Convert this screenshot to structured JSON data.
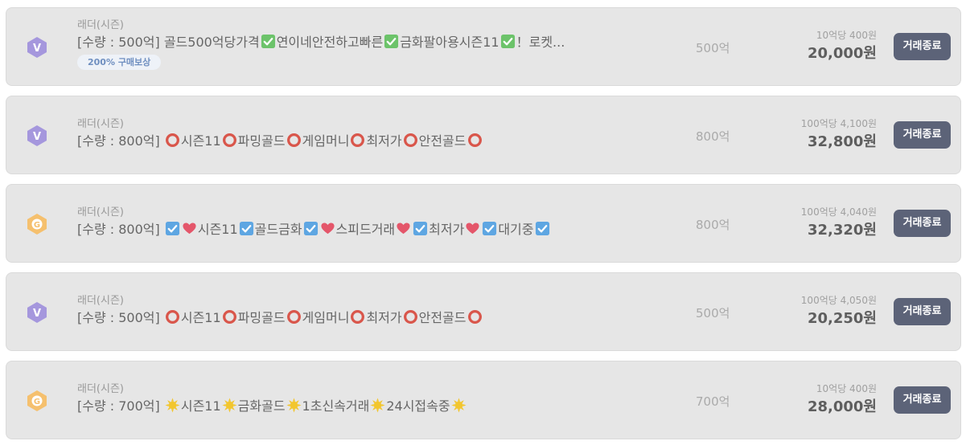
{
  "colors": {
    "card_bg": "#e6e6e6",
    "button_bg": "#5c6378",
    "badge_v": "#a597dd",
    "badge_g": "#f5c06e"
  },
  "listings": [
    {
      "badge": "v-badge-icon",
      "badge_letter": "V",
      "category": "래더(시즌)",
      "title_parts": [
        {
          "t": "[수량 : 500억] 골드500억당가격"
        },
        {
          "e": "check-green"
        },
        {
          "t": "연이네안전하고빠른"
        },
        {
          "e": "check-green"
        },
        {
          "t": "금화팔아용시즌11"
        },
        {
          "e": "check-green"
        },
        {
          "t": "！로켓..."
        }
      ],
      "tag": "200% 구매보상",
      "quantity": "500억",
      "unit_price": "10억당 400원",
      "total": "20,000원",
      "button": "거래종료"
    },
    {
      "badge": "v-badge-icon",
      "badge_letter": "V",
      "category": "래더(시즌)",
      "title_parts": [
        {
          "t": "[수량 : 800억] "
        },
        {
          "e": "ring"
        },
        {
          "t": "시즌11"
        },
        {
          "e": "ring"
        },
        {
          "t": "파밍골드"
        },
        {
          "e": "ring"
        },
        {
          "t": "게임머니"
        },
        {
          "e": "ring"
        },
        {
          "t": "최저가"
        },
        {
          "e": "ring"
        },
        {
          "t": "안전골드"
        },
        {
          "e": "ring"
        }
      ],
      "tag": "",
      "quantity": "800억",
      "unit_price": "100억당 4,100원",
      "total": "32,800원",
      "button": "거래종료"
    },
    {
      "badge": "g-badge-icon",
      "badge_letter": "G",
      "category": "래더(시즌)",
      "title_parts": [
        {
          "t": "[수량 : 800억] "
        },
        {
          "e": "check-blue"
        },
        {
          "e": "heart"
        },
        {
          "t": "시즌11"
        },
        {
          "e": "check-blue"
        },
        {
          "t": "골드금화"
        },
        {
          "e": "check-blue"
        },
        {
          "e": "heart"
        },
        {
          "t": "스피드거래"
        },
        {
          "e": "heart"
        },
        {
          "e": "check-blue"
        },
        {
          "t": "최저가"
        },
        {
          "e": "heart"
        },
        {
          "e": "check-blue"
        },
        {
          "t": "대기중"
        },
        {
          "e": "check-blue"
        }
      ],
      "tag": "",
      "quantity": "800억",
      "unit_price": "100억당 4,040원",
      "total": "32,320원",
      "button": "거래종료"
    },
    {
      "badge": "v-badge-icon",
      "badge_letter": "V",
      "category": "래더(시즌)",
      "title_parts": [
        {
          "t": "[수량 : 500억] "
        },
        {
          "e": "ring"
        },
        {
          "t": "시즌11"
        },
        {
          "e": "ring"
        },
        {
          "t": "파밍골드"
        },
        {
          "e": "ring"
        },
        {
          "t": "게임머니"
        },
        {
          "e": "ring"
        },
        {
          "t": "최저가"
        },
        {
          "e": "ring"
        },
        {
          "t": "안전골드"
        },
        {
          "e": "ring"
        }
      ],
      "tag": "",
      "quantity": "500억",
      "unit_price": "100억당 4,050원",
      "total": "20,250원",
      "button": "거래종료"
    },
    {
      "badge": "g-badge-icon",
      "badge_letter": "G",
      "category": "래더(시즌)",
      "title_parts": [
        {
          "t": "[수량 : 700억] "
        },
        {
          "e": "sun"
        },
        {
          "t": "시즌11"
        },
        {
          "e": "sun"
        },
        {
          "t": "금화골드"
        },
        {
          "e": "sun"
        },
        {
          "t": "1초신속거래"
        },
        {
          "e": "sun"
        },
        {
          "t": "24시접속중"
        },
        {
          "e": "sun"
        }
      ],
      "tag": "",
      "quantity": "700억",
      "unit_price": "10억당 400원",
      "total": "28,000원",
      "button": "거래종료"
    }
  ]
}
